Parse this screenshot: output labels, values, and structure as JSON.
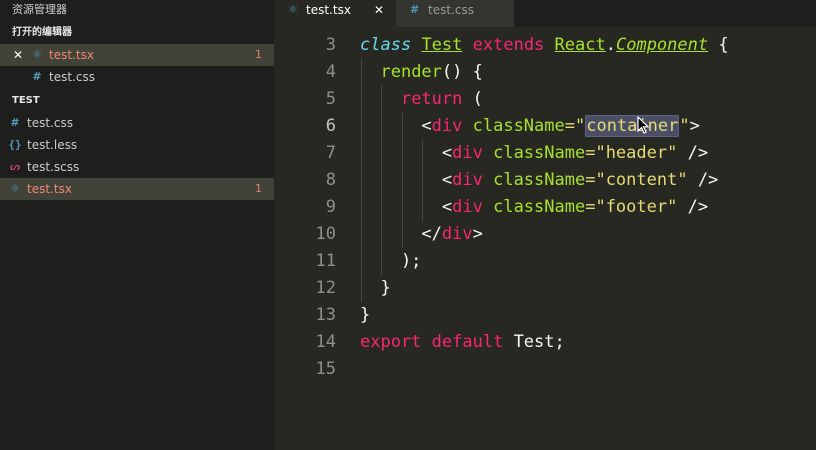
{
  "explorer": {
    "title": "资源管理器",
    "open_editors_title": "打开的编辑器",
    "open_editors": [
      {
        "name": "test.tsx",
        "icon": "react-icon",
        "badge": "1",
        "close": "✕"
      },
      {
        "name": "test.css",
        "icon": "css-icon"
      }
    ],
    "folder_title": "TEST",
    "files": [
      {
        "name": "test.css",
        "icon": "css-icon"
      },
      {
        "name": "test.less",
        "icon": "less-icon"
      },
      {
        "name": "test.scss",
        "icon": "scss-icon"
      },
      {
        "name": "test.tsx",
        "icon": "react-icon",
        "badge": "1"
      }
    ]
  },
  "tabs": [
    {
      "label": "test.tsx",
      "icon": "react-icon",
      "close": "✕",
      "active": true
    },
    {
      "label": "test.css",
      "icon": "css-icon",
      "active": false
    }
  ],
  "editor": {
    "line_numbers": [
      "3",
      "4",
      "5",
      "6",
      "7",
      "8",
      "9",
      "10",
      "11",
      "12",
      "13",
      "14",
      "15"
    ],
    "current_line": "6",
    "lines": [
      [
        {
          "t": "class",
          "c": "storage"
        },
        {
          "t": " ",
          "c": "plain"
        },
        {
          "t": "Test",
          "c": "class"
        },
        {
          "t": " ",
          "c": "plain"
        },
        {
          "t": "extends",
          "c": "kw"
        },
        {
          "t": " ",
          "c": "plain"
        },
        {
          "t": "React",
          "c": "class"
        },
        {
          "t": ".",
          "c": "plain"
        },
        {
          "t": "Component",
          "c": "super"
        },
        {
          "t": " {",
          "c": "plain"
        }
      ],
      [
        {
          "t": "  ",
          "c": "plain"
        },
        {
          "t": "render",
          "c": "fn"
        },
        {
          "t": "() {",
          "c": "plain"
        }
      ],
      [
        {
          "t": "    ",
          "c": "plain"
        },
        {
          "t": "return",
          "c": "kw"
        },
        {
          "t": " (",
          "c": "plain"
        }
      ],
      [
        {
          "t": "      <",
          "c": "plain"
        },
        {
          "t": "div",
          "c": "kw"
        },
        {
          "t": " ",
          "c": "plain"
        },
        {
          "t": "className",
          "c": "attr"
        },
        {
          "t": "=\"",
          "c": "str"
        },
        {
          "t": "container",
          "c": "str-hl"
        },
        {
          "t": "\"",
          "c": "str"
        },
        {
          "t": ">",
          "c": "plain"
        }
      ],
      [
        {
          "t": "        <",
          "c": "plain"
        },
        {
          "t": "div",
          "c": "kw"
        },
        {
          "t": " ",
          "c": "plain"
        },
        {
          "t": "className",
          "c": "attr"
        },
        {
          "t": "=\"header\"",
          "c": "str"
        },
        {
          "t": " />",
          "c": "plain"
        }
      ],
      [
        {
          "t": "        <",
          "c": "plain"
        },
        {
          "t": "div",
          "c": "kw"
        },
        {
          "t": " ",
          "c": "plain"
        },
        {
          "t": "className",
          "c": "attr"
        },
        {
          "t": "=\"content\"",
          "c": "str"
        },
        {
          "t": " />",
          "c": "plain"
        }
      ],
      [
        {
          "t": "        <",
          "c": "plain"
        },
        {
          "t": "div",
          "c": "kw"
        },
        {
          "t": " ",
          "c": "plain"
        },
        {
          "t": "className",
          "c": "attr"
        },
        {
          "t": "=\"footer\"",
          "c": "str"
        },
        {
          "t": " />",
          "c": "plain"
        }
      ],
      [
        {
          "t": "      </",
          "c": "plain"
        },
        {
          "t": "div",
          "c": "kw"
        },
        {
          "t": ">",
          "c": "plain"
        }
      ],
      [
        {
          "t": "    );",
          "c": "plain"
        }
      ],
      [
        {
          "t": "  }",
          "c": "plain"
        }
      ],
      [
        {
          "t": "}",
          "c": "plain"
        }
      ],
      [
        {
          "t": "export",
          "c": "kw"
        },
        {
          "t": " ",
          "c": "plain"
        },
        {
          "t": "default",
          "c": "kw"
        },
        {
          "t": " Test;",
          "c": "plain"
        }
      ],
      []
    ]
  },
  "colors": {
    "background": "#272822",
    "sidebar": "#1e1f1c",
    "error": "#f48771",
    "keyword": "#f92672",
    "string": "#e6db74",
    "entity": "#a6e22e",
    "storage": "#66d9ef"
  }
}
